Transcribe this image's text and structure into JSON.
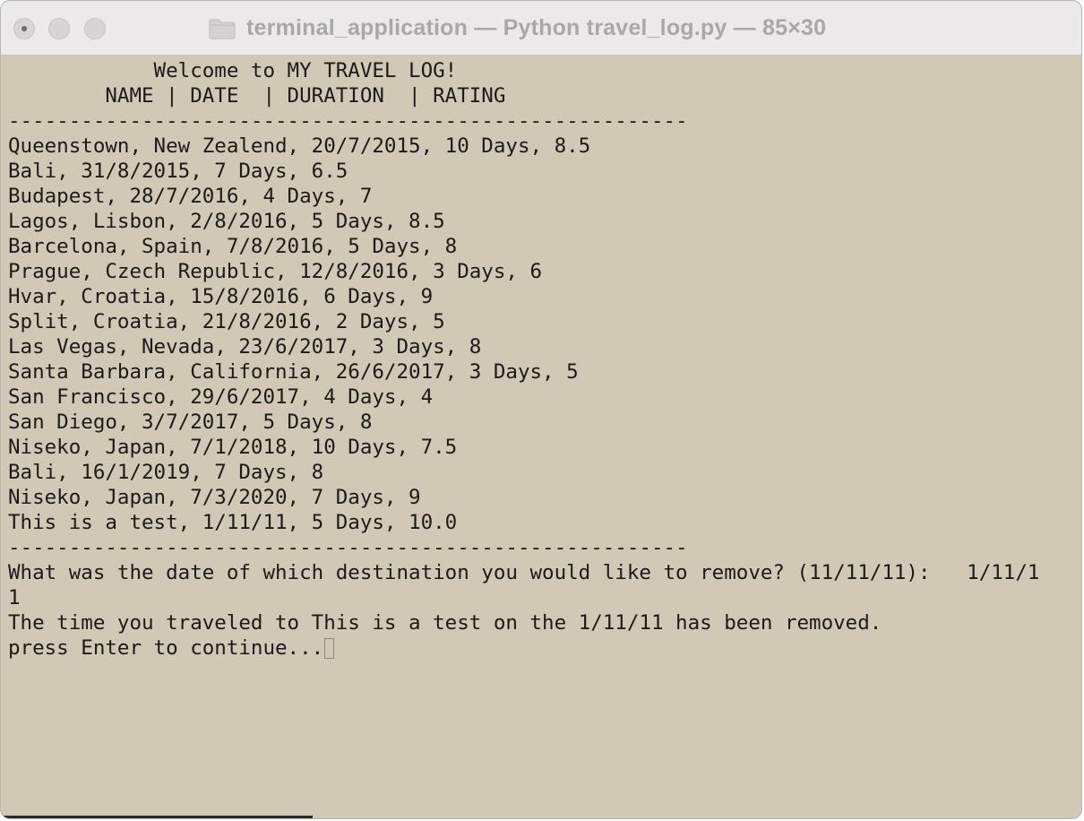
{
  "window": {
    "title": "terminal_application — Python travel_log.py — 85×30",
    "folder_icon": "folder-icon"
  },
  "terminal": {
    "banner": "            Welcome to MY TRAVEL LOG!",
    "header": "        NAME | DATE  | DURATION  | RATING",
    "separator_top": "--------------------------------------------------------",
    "entries": [
      "Queenstown, New Zealend, 20/7/2015, 10 Days, 8.5",
      "Bali, 31/8/2015, 7 Days, 6.5",
      "Budapest, 28/7/2016, 4 Days, 7",
      "Lagos, Lisbon, 2/8/2016, 5 Days, 8.5",
      "Barcelona, Spain, 7/8/2016, 5 Days, 8",
      "Prague, Czech Republic, 12/8/2016, 3 Days, 6",
      "Hvar, Croatia, 15/8/2016, 6 Days, 9",
      "Split, Croatia, 21/8/2016, 2 Days, 5",
      "Las Vegas, Nevada, 23/6/2017, 3 Days, 8",
      "Santa Barbara, California, 26/6/2017, 3 Days, 5",
      "San Francisco, 29/6/2017, 4 Days, 4",
      "San Diego, 3/7/2017, 5 Days, 8",
      "Niseko, Japan, 7/1/2018, 10 Days, 7.5",
      "Bali, 16/1/2019, 7 Days, 8",
      "Niseko, Japan, 7/3/2020, 7 Days, 9",
      "This is a test, 1/11/11, 5 Days, 10.0"
    ],
    "separator_bottom": "--------------------------------------------------------",
    "prompt": "What was the date of which destination you would like to remove? (11/11/11):   1/11/1",
    "prompt_wrap": "1",
    "result": "The time you traveled to This is a test on the 1/11/11 has been removed.",
    "continue": "press Enter to continue..."
  },
  "colors": {
    "terminal_bg": "#d2c8b6",
    "text": "#1b1b1b",
    "titlebar_bg": "#ebe9ea",
    "title_text": "#a9a7a7"
  }
}
